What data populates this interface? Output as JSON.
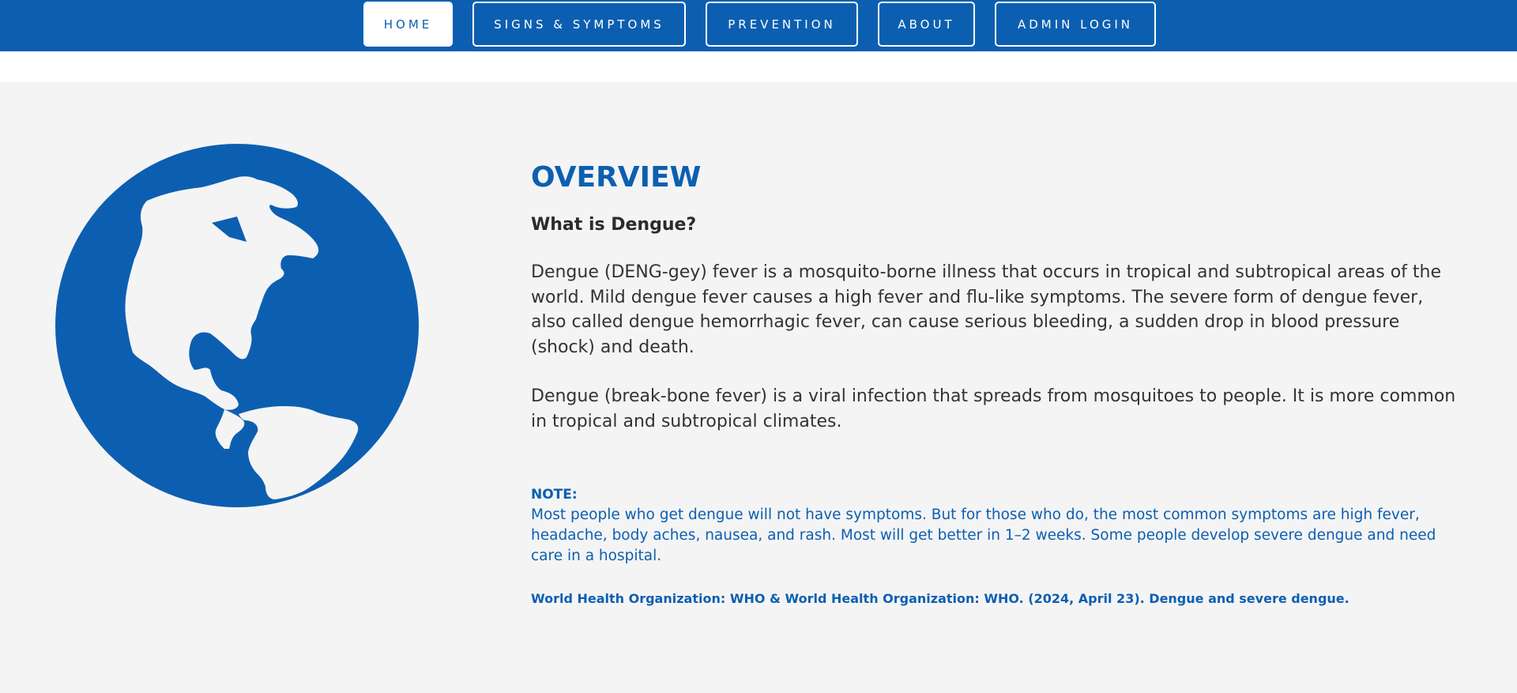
{
  "nav": {
    "home": "HOME",
    "signs": "SIGNS & SYMPTOMS",
    "prevention": "PREVENTION",
    "about": "ABOUT",
    "admin": "ADMIN LOGIN"
  },
  "overview": {
    "title": "OVERVIEW",
    "question": "What is Dengue?",
    "paragraph1": "Dengue (DENG-gey) fever is a mosquito-borne illness that occurs in tropical and subtropical areas of the world. Mild dengue fever causes a high fever and flu-like symptoms. The severe form of dengue fever, also called dengue hemorrhagic fever, can cause serious bleeding, a sudden drop in blood pressure (shock) and death.",
    "paragraph2": "Dengue (break-bone fever) is a viral infection that spreads from mosquitoes to people. It is more common in tropical and subtropical climates.",
    "note_label": "NOTE:",
    "note_text": "Most people who get dengue will not have symptoms. But for those who do, the most common symptoms are high fever, headache, body aches, nausea, and rash. Most will get better in 1–2 weeks. Some people develop severe dengue and need care in a hospital.",
    "citation": "World Health Organization: WHO & World Health Organization: WHO. (2024, April 23). Dengue and severe dengue."
  },
  "icons": {
    "globe": "globe-americas-icon"
  },
  "colors": {
    "primary": "#0c5fb0",
    "background": "#f4f4f5",
    "text": "#333333"
  }
}
